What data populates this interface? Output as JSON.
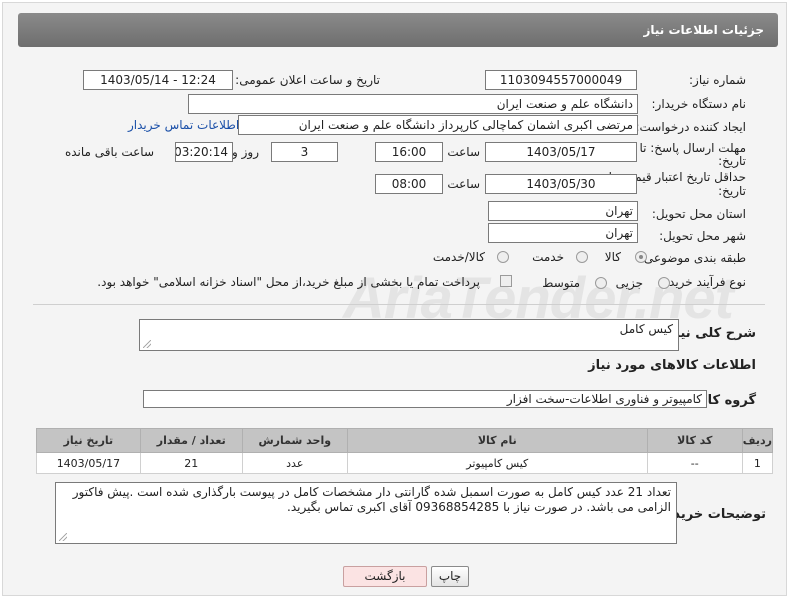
{
  "header": {
    "title": "جزئیات اطلاعات نیاز"
  },
  "watermark": "AriaTender.net",
  "fields": {
    "need_number_label": "شماره نیاز:",
    "need_number": "1103094557000049",
    "announce_label": "تاریخ و ساعت اعلان عمومی:",
    "announce_value": "1403/05/14 - 12:24",
    "buyer_label": "نام دستگاه خریدار:",
    "buyer_value": "دانشگاه علم و صنعت ایران",
    "creator_label": "ایجاد کننده درخواست:",
    "creator_value": "مرتضی اکبری اشمان کماچالی کارپرداز دانشگاه علم و صنعت ایران",
    "contact_link": "اطلاعات تماس خریدار",
    "reply_deadline_label_1": "مهلت ارسال پاسخ: تا",
    "reply_deadline_label_2": "تاریخ:",
    "reply_date": "1403/05/17",
    "time_label": "ساعت",
    "reply_time": "16:00",
    "days_value": "3",
    "days_label": "روز و",
    "remaining_value": "03:20:14",
    "remaining_label": "ساعت باقی مانده",
    "validity_label_1": "حداقل تاریخ اعتبار قیمت: تا",
    "validity_label_2": "تاریخ:",
    "validity_date": "1403/05/30",
    "validity_time_label": "ساعت",
    "validity_time": "08:00",
    "province_label": "استان محل تحویل:",
    "province_value": "تهران",
    "city_label": "شهر محل تحویل:",
    "city_value": "تهران",
    "category_label": "طبقه بندی موضوعی:",
    "category_options": [
      "کالا",
      "خدمت",
      "کالا/خدمت"
    ],
    "process_label": "نوع فرآیند خرید :",
    "process_options": [
      "جزیی",
      "متوسط"
    ],
    "payment_note": "پرداخت تمام یا بخشی از مبلغ خرید،از محل \"اسناد خزانه اسلامی\" خواهد بود."
  },
  "summary": {
    "label": "شرح کلی نیاز:",
    "value": "کیس کامل"
  },
  "goods_section_title": "اطلاعات کالاهای مورد نیاز",
  "group": {
    "label": "گروه کالا:",
    "value": "کامپیوتر و فناوری اطلاعات-سخت افزار"
  },
  "table": {
    "headers": [
      "ردیف",
      "کد کالا",
      "نام کالا",
      "واحد شمارش",
      "تعداد / مقدار",
      "تاریخ نیاز"
    ],
    "rows": [
      [
        "1",
        "--",
        "کیس کامپیوتر",
        "عدد",
        "21",
        "1403/05/17"
      ]
    ]
  },
  "notes": {
    "label": "توضیحات خریدار:",
    "value": "تعداد 21 عدد کیس کامل به صورت اسمبل شده گارانتی دار مشخصات کامل در پیوست بارگذاری شده است .پیش فاکتور الزامی می باشد. در صورت نیاز با 09368854285 آقای اکبری تماس بگیرید."
  },
  "buttons": {
    "print": "چاپ",
    "back": "بازگشت"
  }
}
